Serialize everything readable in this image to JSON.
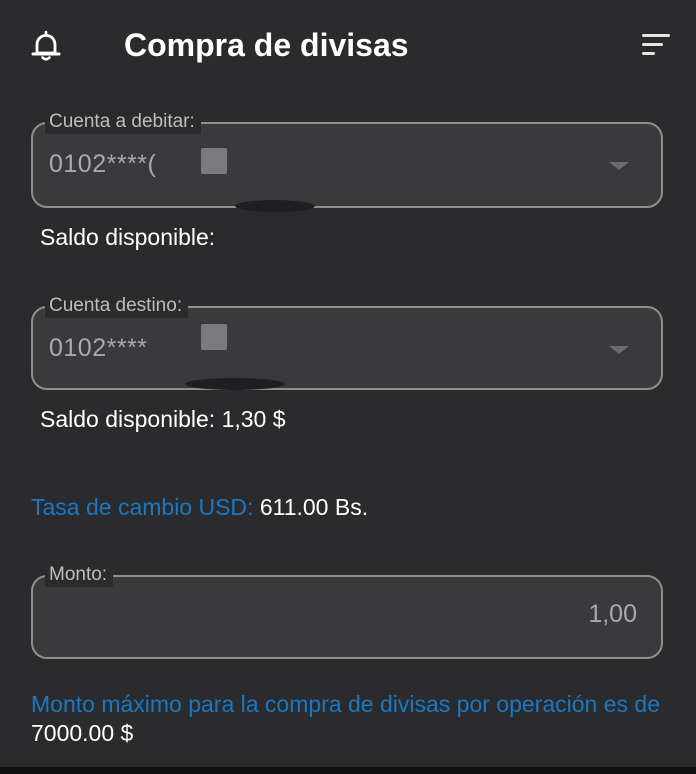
{
  "header": {
    "title": "Compra de divisas",
    "icons": {
      "left": "bell-icon",
      "right": "menu-icon"
    }
  },
  "debit_account": {
    "label": "Cuenta a debitar:",
    "value": "0102****(",
    "balance_label": "Saldo disponible:"
  },
  "destination_account": {
    "label": "Cuenta destino:",
    "value": "0102****",
    "balance_label": "Saldo disponible: 1,30 $"
  },
  "exchange_rate": {
    "label": "Tasa de cambio USD:",
    "value": "611.00 Bs."
  },
  "amount": {
    "label": "Monto:",
    "value": "1,00"
  },
  "limit_note": {
    "text": "Monto máximo para la compra de divisas por operación es de",
    "value": "7000.00 $"
  },
  "colors": {
    "background": "#2b2b2d",
    "field_background": "#3a3a3c",
    "accent": "#1a78c2",
    "field_border": "#8f8f90"
  }
}
